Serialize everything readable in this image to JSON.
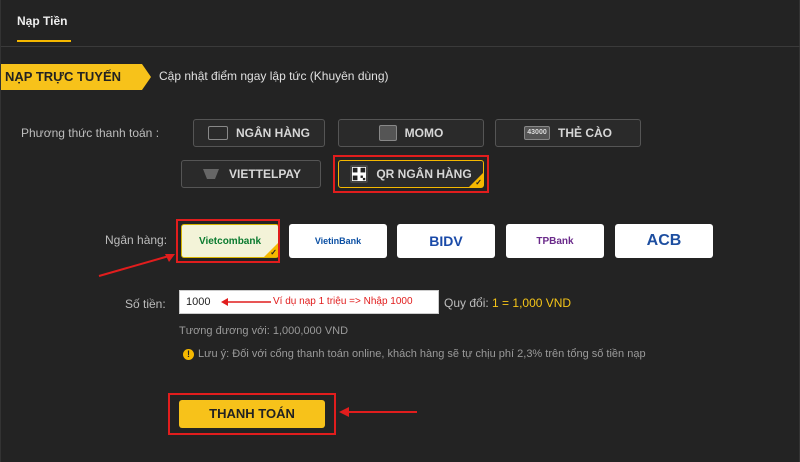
{
  "tab": {
    "label": "Nạp Tiền"
  },
  "ribbon": {
    "label": "NẠP TRỰC TUYẾN",
    "description": "Cập nhật điểm ngay lập tức (Khuyên dùng)"
  },
  "payment": {
    "label": "Phương thức thanh toán :",
    "methods": [
      {
        "label": "NGÂN HÀNG",
        "icon": "bank-card-icon"
      },
      {
        "label": "MOMO",
        "icon": "momo-icon"
      },
      {
        "label": "THẺ CÀO",
        "icon": "scratch-card-icon",
        "icon_text": "43000"
      },
      {
        "label": "VIETTELPAY",
        "icon": "viettelpay-icon"
      },
      {
        "label": "QR NGÂN HÀNG",
        "icon": "qr-code-icon",
        "selected": true
      }
    ]
  },
  "banks": {
    "label": "Ngân hàng:",
    "items": [
      {
        "label": "Vietcombank",
        "color": "#0a7a2f",
        "selected": true
      },
      {
        "label": "VietinBank",
        "color": "#0b4fa3"
      },
      {
        "label": "BIDV",
        "color": "#1a4aa8"
      },
      {
        "label": "TPBank",
        "color": "#6a2a8a"
      },
      {
        "label": "ACB",
        "color": "#1d4ea0"
      }
    ]
  },
  "amount": {
    "label": "Số tiền:",
    "value": "1000",
    "hint": "Ví dụ nạp 1 triệu => Nhập 1000",
    "conversion_label": "Quy đổi:",
    "conversion_value": "1 = 1,000 VND",
    "equivalent": "Tương đương với: 1,000,000 VND"
  },
  "note": {
    "text": "Lưu ý: Đối với cổng thanh toán online, khách hàng sẽ tự chịu phí 2,3% trên tổng số tiền nạp"
  },
  "submit": {
    "label": "THANH TOÁN"
  },
  "colors": {
    "accent": "#f5b800",
    "highlight": "#e11d1d",
    "background": "#232323"
  }
}
